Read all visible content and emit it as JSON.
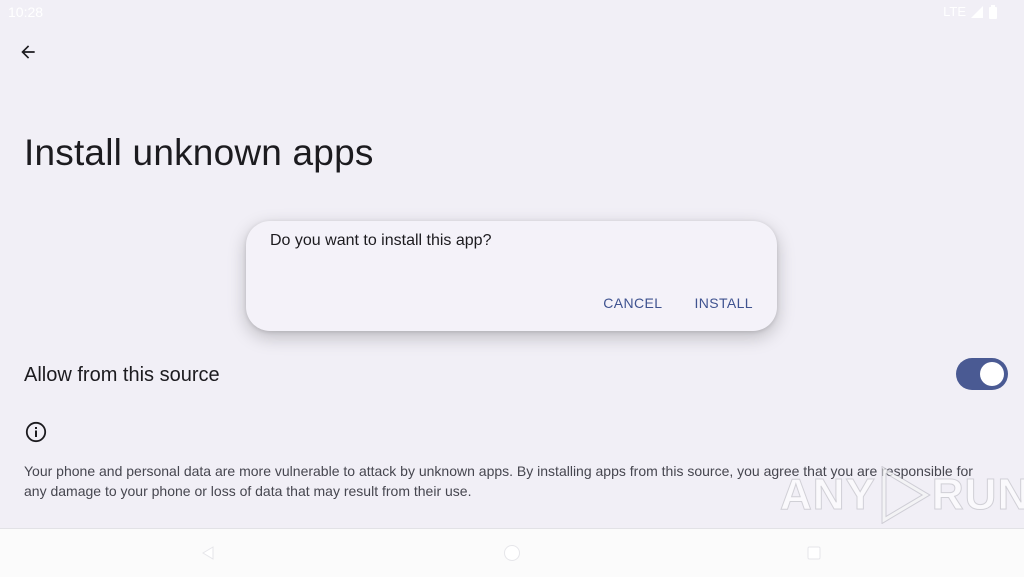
{
  "status_bar": {
    "time": "10:28",
    "network": "LTE"
  },
  "page": {
    "title": "Install unknown apps"
  },
  "dialog": {
    "message": "Do you want to install this app?",
    "cancel_label": "CANCEL",
    "install_label": "INSTALL"
  },
  "setting": {
    "label": "Allow from this source",
    "enabled": true
  },
  "info": {
    "text": "Your phone and personal data are more vulnerable to attack by unknown apps. By installing apps from this source, you agree that you are responsible for any damage to your phone or loss of data that may result from their use."
  },
  "watermark": {
    "left": "ANY",
    "right": "RUN"
  },
  "colors": {
    "background": "#f1eff6",
    "accent": "#3f5390",
    "toggle_track": "#4a5a93"
  },
  "icons": {
    "back": "arrow-back-icon",
    "info": "info-icon",
    "nav_back": "triangle-back-icon",
    "nav_home": "circle-home-icon",
    "nav_recents": "square-recents-icon"
  }
}
